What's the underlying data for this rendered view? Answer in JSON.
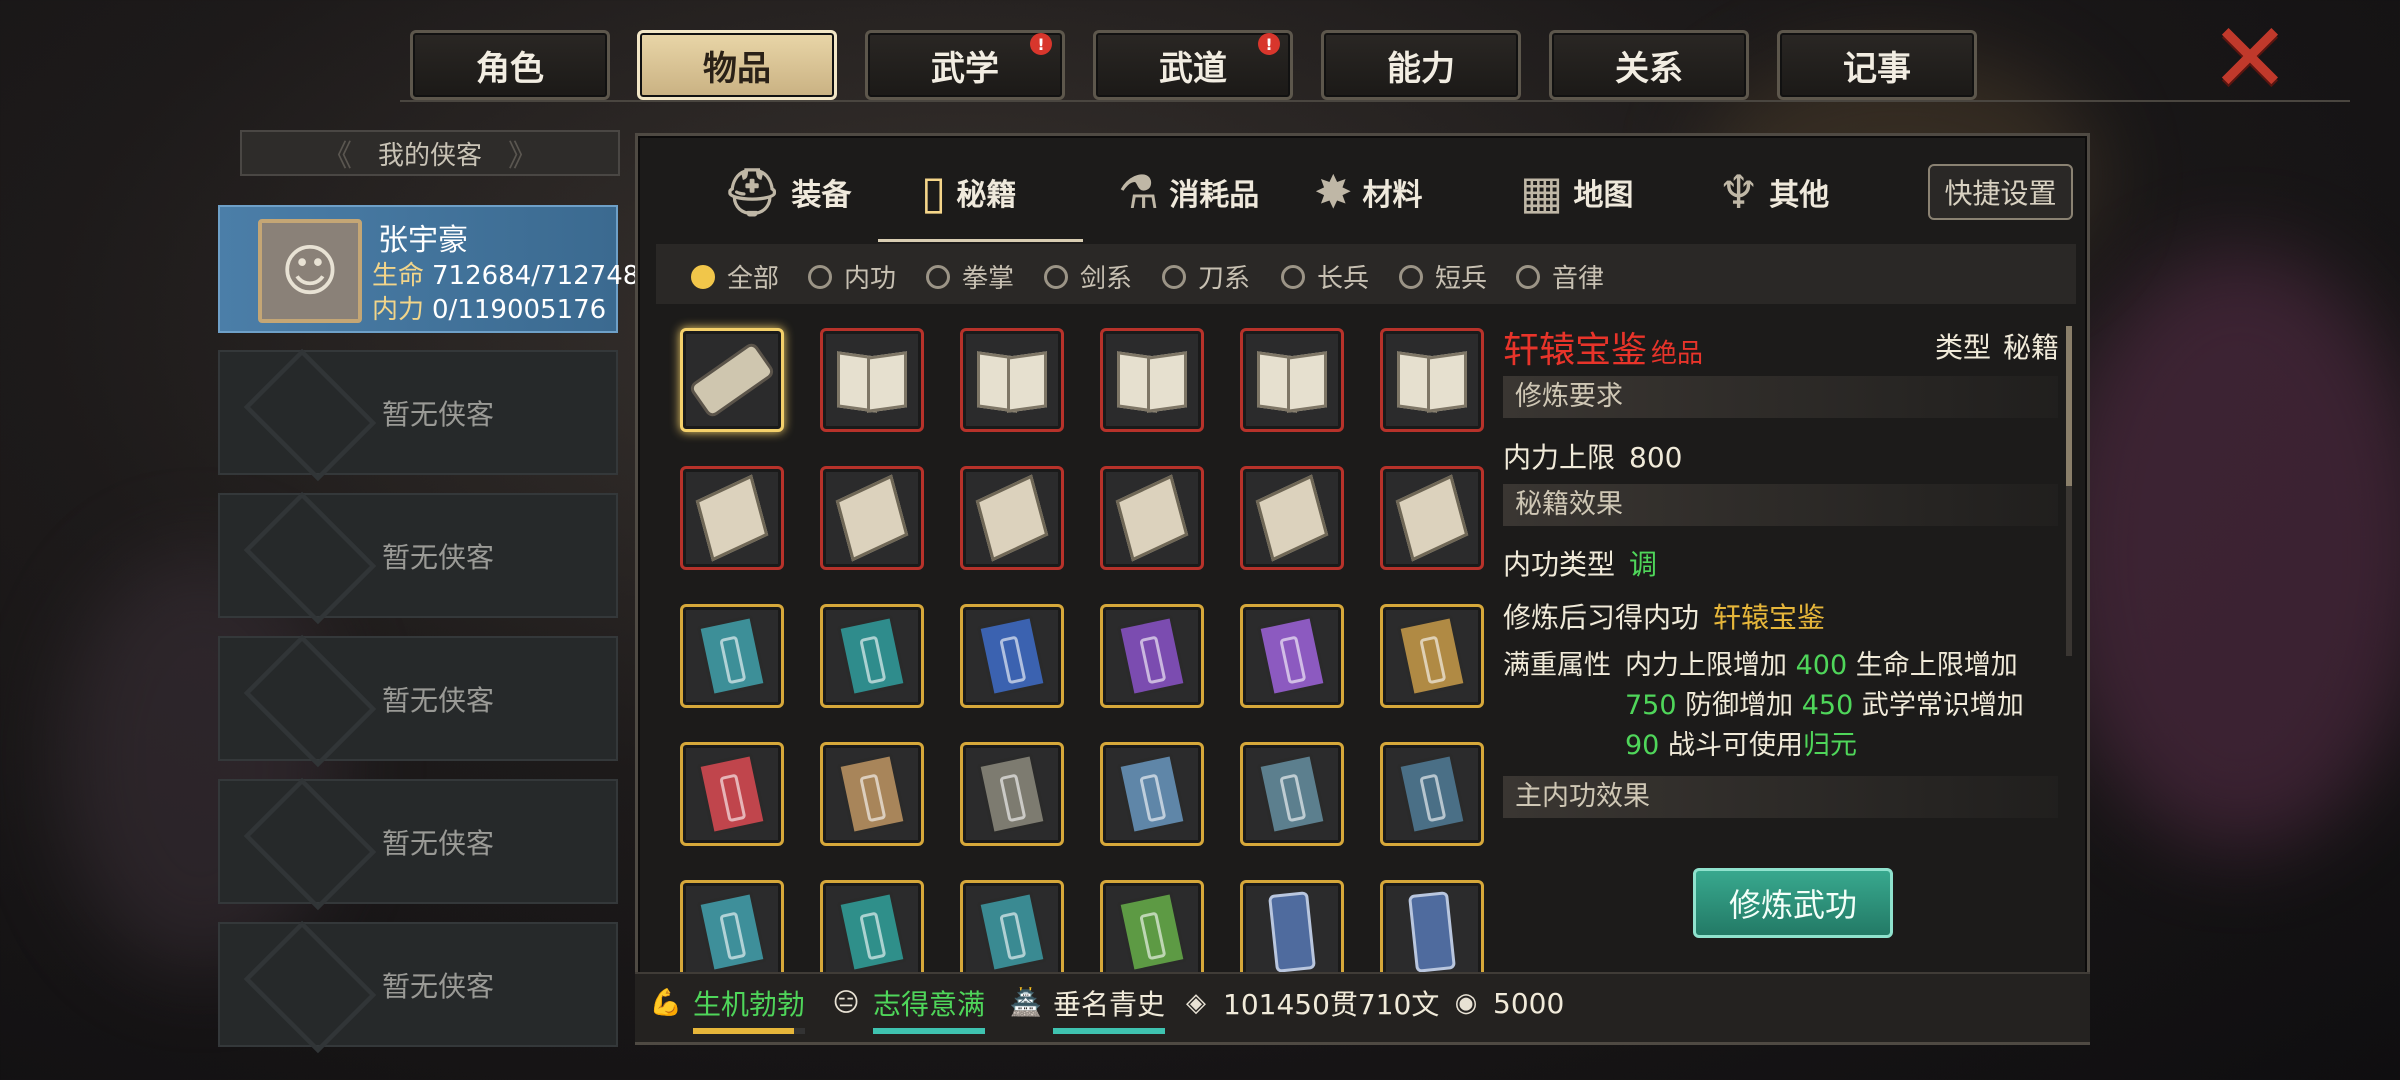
{
  "top_tabs": [
    {
      "label": "角色",
      "active": false,
      "badge": ""
    },
    {
      "label": "物品",
      "active": true,
      "badge": ""
    },
    {
      "label": "武学",
      "active": false,
      "badge": "!"
    },
    {
      "label": "武道",
      "active": false,
      "badge": "!"
    },
    {
      "label": "能力",
      "active": false,
      "badge": ""
    },
    {
      "label": "关系",
      "active": false,
      "badge": ""
    },
    {
      "label": "记事",
      "active": false,
      "badge": ""
    }
  ],
  "close_glyph": "✕",
  "left_panel": {
    "title": "我的侠客",
    "character": {
      "name": "张宇豪",
      "hp_label": "生命",
      "hp_value": "712684/712748",
      "mp_label": "内力",
      "mp_value": "0/119005176",
      "avatar_icon": "helmet-warrior-icon"
    },
    "empty_slots": [
      "暂无侠客",
      "暂无侠客",
      "暂无侠客",
      "暂无侠客",
      "暂无侠客"
    ]
  },
  "category_tabs": [
    {
      "label": "装备",
      "icon": "⛑",
      "active": false
    },
    {
      "label": "秘籍",
      "icon": "▯",
      "active": true
    },
    {
      "label": "消耗品",
      "icon": "⚗",
      "active": false
    },
    {
      "label": "材料",
      "icon": "✸",
      "active": false
    },
    {
      "label": "地图",
      "icon": "▦",
      "active": false
    },
    {
      "label": "其他",
      "icon": "♆",
      "active": false
    }
  ],
  "quick_settings_label": "快捷设置",
  "filters": [
    {
      "label": "全部",
      "active": true
    },
    {
      "label": "内功",
      "active": false
    },
    {
      "label": "拳掌",
      "active": false
    },
    {
      "label": "剑系",
      "active": false
    },
    {
      "label": "刀系",
      "active": false
    },
    {
      "label": "长兵",
      "active": false
    },
    {
      "label": "短兵",
      "active": false
    },
    {
      "label": "音律",
      "active": false
    }
  ],
  "grid": [
    [
      {
        "kind": "scroll",
        "frame": "gold",
        "selected": true
      },
      {
        "kind": "open",
        "frame": "red"
      },
      {
        "kind": "open",
        "frame": "red"
      },
      {
        "kind": "open",
        "frame": "red"
      },
      {
        "kind": "open",
        "frame": "red"
      },
      {
        "kind": "open",
        "frame": "red"
      }
    ],
    [
      {
        "kind": "old",
        "frame": "red"
      },
      {
        "kind": "old",
        "frame": "red"
      },
      {
        "kind": "old",
        "frame": "red"
      },
      {
        "kind": "old",
        "frame": "red"
      },
      {
        "kind": "old",
        "frame": "red"
      },
      {
        "kind": "old",
        "frame": "red"
      }
    ],
    [
      {
        "kind": "closed",
        "color": "#3d8f98",
        "frame": "gold"
      },
      {
        "kind": "closed",
        "color": "#2f8c8c",
        "frame": "gold"
      },
      {
        "kind": "closed",
        "color": "#3b62b0",
        "frame": "gold"
      },
      {
        "kind": "closed",
        "color": "#7b4cb0",
        "frame": "gold"
      },
      {
        "kind": "closed",
        "color": "#8c5ac0",
        "frame": "gold"
      },
      {
        "kind": "closed",
        "color": "#b08a44",
        "frame": "gold"
      }
    ],
    [
      {
        "kind": "closed",
        "color": "#c0454c",
        "frame": "gold"
      },
      {
        "kind": "closed",
        "color": "#a8855a",
        "frame": "gold"
      },
      {
        "kind": "closed",
        "color": "#7d7b70",
        "frame": "gold"
      },
      {
        "kind": "closed",
        "color": "#5f86a8",
        "frame": "gold"
      },
      {
        "kind": "closed",
        "color": "#5c7f8e",
        "frame": "gold"
      },
      {
        "kind": "closed",
        "color": "#4a6f86",
        "frame": "gold"
      }
    ],
    [
      {
        "kind": "closed",
        "color": "#3e8f9a",
        "frame": "gold"
      },
      {
        "kind": "closed",
        "color": "#2f8f8a",
        "frame": "gold"
      },
      {
        "kind": "closed",
        "color": "#3a8a92",
        "frame": "gold"
      },
      {
        "kind": "closed",
        "color": "#5d9a44",
        "frame": "gold"
      },
      {
        "kind": "ticket",
        "frame": "gold"
      },
      {
        "kind": "ticket",
        "frame": "gold"
      }
    ]
  ],
  "detail": {
    "name": "轩辕宝鉴",
    "grade": "绝品",
    "type_label": "类型",
    "type_value": "秘籍",
    "req_header": "修炼要求",
    "req_label": "内力上限",
    "req_value": "800",
    "effect_header": "秘籍效果",
    "inner_type_label": "内功类型",
    "inner_type_value": "调",
    "learn_label": "修炼后习得内功",
    "learn_value": "轩辕宝鉴",
    "attr_label": "满重属性",
    "attr_parts": [
      {
        "t": "内力上限增加 ",
        "c": ""
      },
      {
        "t": "400",
        "c": "green"
      },
      {
        "t": " 生命上限增加 ",
        "c": ""
      },
      {
        "t": "750",
        "c": "green"
      },
      {
        "t": " 防御增加 ",
        "c": ""
      },
      {
        "t": "450",
        "c": "green"
      },
      {
        "t": " 武学常识增加 ",
        "c": ""
      },
      {
        "t": "90",
        "c": "green"
      },
      {
        "t": " 战斗可使用",
        "c": ""
      },
      {
        "t": "归元",
        "c": "green"
      }
    ],
    "main_header": "主内功效果",
    "train_button": "修炼武功"
  },
  "bottom_stats": [
    {
      "label": "生机勃勃",
      "icon": "muscle-icon",
      "glyph": "💪",
      "color": "#4fd65a",
      "bar_color": "#e6b63a",
      "bar_fraction": 0.9
    },
    {
      "label": "志得意满",
      "icon": "face-icon",
      "glyph": "😑",
      "color": "#4fd65a",
      "bar_color": "#3fc3b0",
      "bar_fraction": 1.0
    },
    {
      "label": "垂名青史",
      "icon": "scroll-badge-icon",
      "glyph": "🏯",
      "color": "#f0ead9",
      "bar_color": "#3fc3b0",
      "bar_fraction": 1.0
    },
    {
      "label": "101450贯710文",
      "icon": "coin-icon",
      "glyph": "◈",
      "color": "#f0ead9"
    },
    {
      "label": "5000",
      "icon": "jade-icon",
      "glyph": "◉",
      "color": "#f0ead9"
    }
  ]
}
